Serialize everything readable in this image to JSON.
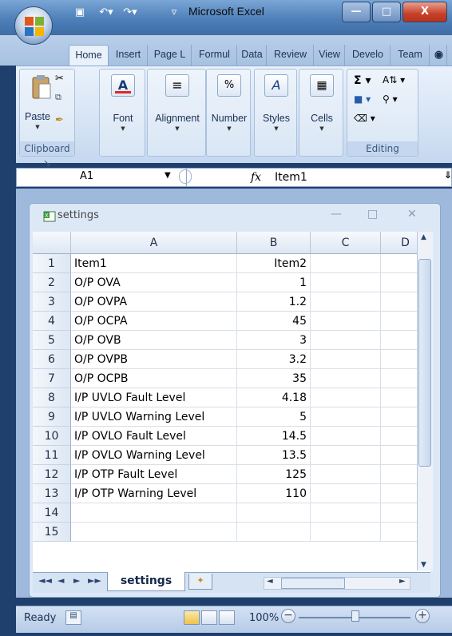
{
  "window": {
    "title": "Microsoft Excel",
    "minimize_label": "—",
    "maximize_label": "□",
    "close_label": "X"
  },
  "ribbon": {
    "tabs": [
      "Home",
      "Insert",
      "Page L",
      "Formul",
      "Data",
      "Review",
      "View",
      "Develo",
      "Team"
    ],
    "active_tab": "Home",
    "groups": {
      "clipboard": {
        "label": "Clipboard",
        "paste": "Paste"
      },
      "font": "Font",
      "alignment": "Alignment",
      "number": "Number",
      "styles": "Styles",
      "cells": "Cells",
      "editing": "Editing"
    }
  },
  "formula_bar": {
    "name_box": "A1",
    "fx": "fx",
    "formula": "Item1"
  },
  "workbook": {
    "title": "settings",
    "columns": [
      "A",
      "B",
      "C",
      "D"
    ],
    "rows": [
      {
        "n": "1",
        "a": "Item1",
        "b": "Item2"
      },
      {
        "n": "2",
        "a": "O/P OVA",
        "b": "1"
      },
      {
        "n": "3",
        "a": "O/P OVPA",
        "b": "1.2"
      },
      {
        "n": "4",
        "a": "O/P OCPA",
        "b": "45"
      },
      {
        "n": "5",
        "a": "O/P OVB",
        "b": "3"
      },
      {
        "n": "6",
        "a": "O/P OVPB",
        "b": "3.2"
      },
      {
        "n": "7",
        "a": "O/P OCPB",
        "b": "35"
      },
      {
        "n": "8",
        "a": "I/P UVLO Fault Level",
        "b": "4.18"
      },
      {
        "n": "9",
        "a": "I/P UVLO Warning Level",
        "b": "5"
      },
      {
        "n": "10",
        "a": "I/P OVLO Fault Level",
        "b": "14.5"
      },
      {
        "n": "11",
        "a": "I/P OVLO Warning Level",
        "b": "13.5"
      },
      {
        "n": "12",
        "a": "I/P OTP Fault Level",
        "b": "125"
      },
      {
        "n": "13",
        "a": "I/P OTP Warning Level",
        "b": "110"
      },
      {
        "n": "14",
        "a": "",
        "b": ""
      },
      {
        "n": "15",
        "a": "",
        "b": ""
      }
    ],
    "sheet_tab": "settings"
  },
  "status_bar": {
    "ready": "Ready",
    "zoom": "100%"
  },
  "colors": {
    "titlebar": "#4e7fb8",
    "ribbon": "#d5e3f4",
    "grid_header": "#dde7f3"
  }
}
